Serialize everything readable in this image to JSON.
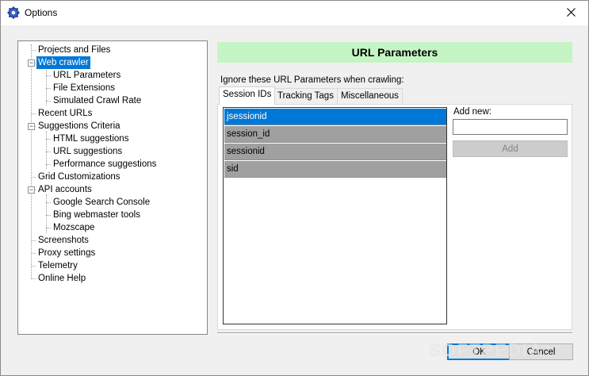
{
  "window": {
    "title": "Options",
    "icon": "gear-icon"
  },
  "tree": {
    "items": [
      {
        "label": "Projects and Files"
      },
      {
        "label": "Web crawler"
      },
      {
        "label": "URL Parameters"
      },
      {
        "label": "File Extensions"
      },
      {
        "label": "Simulated Crawl Rate"
      },
      {
        "label": "Recent URLs"
      },
      {
        "label": "Suggestions Criteria"
      },
      {
        "label": "HTML suggestions"
      },
      {
        "label": "URL suggestions"
      },
      {
        "label": "Performance suggestions"
      },
      {
        "label": "Grid Customizations"
      },
      {
        "label": "API accounts"
      },
      {
        "label": "Google Search Console"
      },
      {
        "label": "Bing webmaster tools"
      },
      {
        "label": "Mozscape"
      },
      {
        "label": "Screenshots"
      },
      {
        "label": "Proxy settings"
      },
      {
        "label": "Telemetry"
      },
      {
        "label": "Online Help"
      }
    ],
    "selected": "Web crawler"
  },
  "panel": {
    "header": "URL Parameters",
    "header_color": "#c5f5c5",
    "ignore_label": "Ignore these URL Parameters when crawling:",
    "tabs": [
      "Session IDs",
      "Tracking Tags",
      "Miscellaneous"
    ],
    "active_tab": "Session IDs",
    "session_ids": [
      "jsessionid",
      "session_id",
      "sessionid",
      "sid"
    ],
    "add_new_label": "Add new:",
    "add_new_value": "",
    "add_button": "Add"
  },
  "footer": {
    "ok": "OK",
    "cancel": "Cancel"
  },
  "watermark": "SOFTPEDIA",
  "colors": {
    "selection": "#0078d7",
    "list_row": "#a0a0a0"
  }
}
